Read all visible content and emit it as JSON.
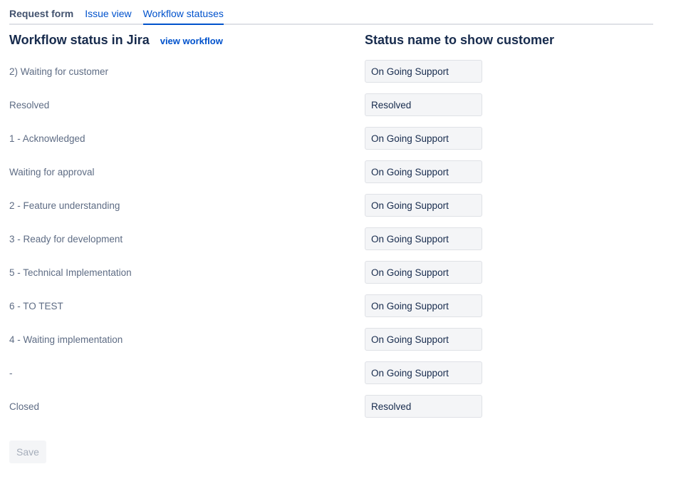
{
  "tabs": [
    {
      "label": "Request form"
    },
    {
      "label": "Issue view"
    },
    {
      "label": "Workflow statuses"
    }
  ],
  "left_heading": "Workflow status in Jira",
  "view_workflow_link": "view workflow",
  "right_heading": "Status name to show customer",
  "rows": [
    {
      "status": "2) Waiting for customer",
      "customer_name": "On Going Support"
    },
    {
      "status": "Resolved",
      "customer_name": "Resolved"
    },
    {
      "status": "1 - Acknowledged",
      "customer_name": "On Going Support"
    },
    {
      "status": "Waiting for approval",
      "customer_name": "On Going Support"
    },
    {
      "status": "2 - Feature understanding",
      "customer_name": "On Going Support"
    },
    {
      "status": "3 - Ready for development",
      "customer_name": "On Going Support"
    },
    {
      "status": "5 - Technical Implementation",
      "customer_name": "On Going Support"
    },
    {
      "status": "6 - TO TEST",
      "customer_name": "On Going Support"
    },
    {
      "status": "4 - Waiting implementation",
      "customer_name": "On Going Support"
    },
    {
      "status": "-",
      "customer_name": "On Going Support"
    },
    {
      "status": "Closed",
      "customer_name": "Resolved"
    }
  ],
  "save_label": "Save",
  "colors": {
    "link": "#0052cc",
    "text_primary": "#172b4d",
    "text_secondary": "#5e6c84",
    "input_bg": "#f4f5f7",
    "border": "#dfe1e6"
  }
}
